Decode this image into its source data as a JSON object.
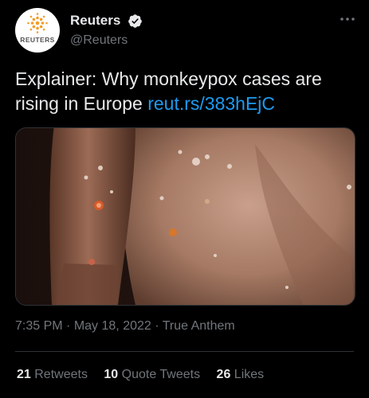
{
  "account": {
    "display_name": "Reuters",
    "handle": "@Reuters",
    "avatar_text": "REUTERS",
    "verified_icon": "verified-badge-icon"
  },
  "tweet": {
    "text": "Explainer: Why monkeypox cases are rising in Europe",
    "link": "reut.rs/383hEjC"
  },
  "meta": {
    "time": "7:35 PM",
    "sep1": "·",
    "date": "May 18, 2022",
    "sep2": "·",
    "source": "True Anthem"
  },
  "stats": {
    "retweets_count": "21",
    "retweets_label": "Retweets",
    "quotes_count": "10",
    "quotes_label": "Quote Tweets",
    "likes_count": "26",
    "likes_label": "Likes"
  },
  "colors": {
    "background": "#000000",
    "text": "#e7e9ea",
    "muted": "#71767b",
    "link": "#1d9bf0",
    "brand_orange": "#f39c2b"
  }
}
